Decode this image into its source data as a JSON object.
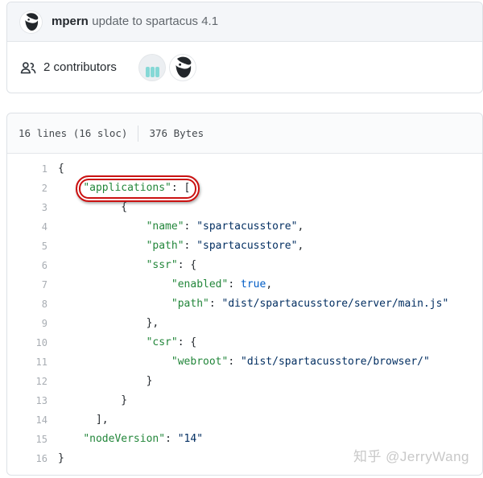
{
  "commit": {
    "author": "mpern",
    "message": "update to spartacus 4.1",
    "avatar_icon": "beard-man-avatar"
  },
  "contributors": {
    "count_label": "2 contributors",
    "icon": "people-icon",
    "avatars": [
      "identicon-teal-bars-avatar",
      "beard-man-avatar"
    ]
  },
  "file": {
    "lines_info": "16 lines (16 sloc)",
    "size_info": "376 Bytes"
  },
  "watermark": "知乎 @JerryWang",
  "colors": {
    "key": "#22863a",
    "str": "#032f62",
    "bool": "#005cc5",
    "red": "#cb1111",
    "teal": "#85d8d6"
  },
  "code": {
    "lines": [
      {
        "num": "1",
        "segments": [
          {
            "t": "p",
            "v": "{"
          }
        ]
      },
      {
        "num": "2",
        "segments": [
          {
            "t": "p",
            "v": "    "
          },
          {
            "t": "k",
            "v": "\"applications\"",
            "a": true
          },
          {
            "t": "p",
            "v": ": [",
            "a": true
          }
        ]
      },
      {
        "num": "3",
        "segments": [
          {
            "t": "p",
            "v": "          {"
          }
        ]
      },
      {
        "num": "4",
        "segments": [
          {
            "t": "p",
            "v": "              "
          },
          {
            "t": "k",
            "v": "\"name\""
          },
          {
            "t": "p",
            "v": ": "
          },
          {
            "t": "s",
            "v": "\"spartacusstore\""
          },
          {
            "t": "p",
            "v": ","
          }
        ]
      },
      {
        "num": "5",
        "segments": [
          {
            "t": "p",
            "v": "              "
          },
          {
            "t": "k",
            "v": "\"path\""
          },
          {
            "t": "p",
            "v": ": "
          },
          {
            "t": "s",
            "v": "\"spartacusstore\""
          },
          {
            "t": "p",
            "v": ","
          }
        ]
      },
      {
        "num": "6",
        "segments": [
          {
            "t": "p",
            "v": "              "
          },
          {
            "t": "k",
            "v": "\"ssr\""
          },
          {
            "t": "p",
            "v": ": {"
          }
        ]
      },
      {
        "num": "7",
        "segments": [
          {
            "t": "p",
            "v": "                  "
          },
          {
            "t": "k",
            "v": "\"enabled\""
          },
          {
            "t": "p",
            "v": ": "
          },
          {
            "t": "b",
            "v": "true"
          },
          {
            "t": "p",
            "v": ","
          }
        ]
      },
      {
        "num": "8",
        "segments": [
          {
            "t": "p",
            "v": "                  "
          },
          {
            "t": "k",
            "v": "\"path\""
          },
          {
            "t": "p",
            "v": ": "
          },
          {
            "t": "s",
            "v": "\"dist/spartacusstore/server/main.js\""
          }
        ]
      },
      {
        "num": "9",
        "segments": [
          {
            "t": "p",
            "v": "              },"
          }
        ]
      },
      {
        "num": "10",
        "segments": [
          {
            "t": "p",
            "v": "              "
          },
          {
            "t": "k",
            "v": "\"csr\""
          },
          {
            "t": "p",
            "v": ": {"
          }
        ]
      },
      {
        "num": "11",
        "segments": [
          {
            "t": "p",
            "v": "                  "
          },
          {
            "t": "k",
            "v": "\"webroot\""
          },
          {
            "t": "p",
            "v": ": "
          },
          {
            "t": "s",
            "v": "\"dist/spartacusstore/browser/\""
          }
        ]
      },
      {
        "num": "12",
        "segments": [
          {
            "t": "p",
            "v": "              }"
          }
        ]
      },
      {
        "num": "13",
        "segments": [
          {
            "t": "p",
            "v": "          }"
          }
        ]
      },
      {
        "num": "14",
        "segments": [
          {
            "t": "p",
            "v": "      ],"
          }
        ]
      },
      {
        "num": "15",
        "segments": [
          {
            "t": "p",
            "v": "    "
          },
          {
            "t": "k",
            "v": "\"nodeVersion\""
          },
          {
            "t": "p",
            "v": ": "
          },
          {
            "t": "s",
            "v": "\"14\""
          }
        ]
      },
      {
        "num": "16",
        "segments": [
          {
            "t": "p",
            "v": "}"
          }
        ]
      }
    ]
  }
}
